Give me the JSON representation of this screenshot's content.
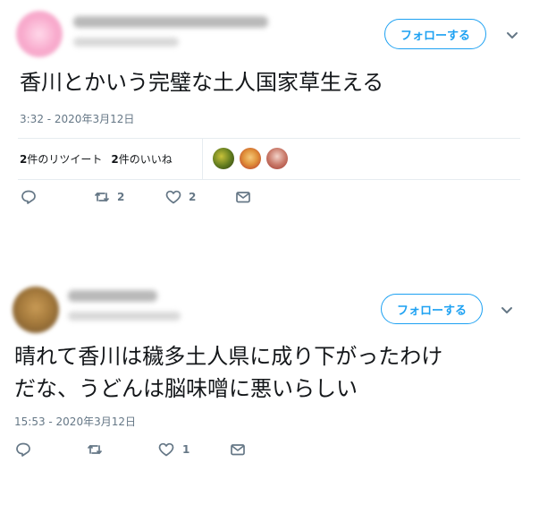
{
  "tweets": [
    {
      "follow_label": "フォローする",
      "text": "香川とかいう完璧な土人国家草生える",
      "timestamp": "3:32 - 2020年3月12日",
      "retweets_count": "2",
      "retweets_label": "件のリツイート",
      "likes_count": "2",
      "likes_label": "件のいいね",
      "actions": {
        "retweet_count": "2",
        "like_count": "2"
      }
    },
    {
      "follow_label": "フォローする",
      "text": "晴れて香川は穢多土人県に成り下がったわけ\nだな、うどんは脳味噌に悪いらしい",
      "timestamp": "15:53 - 2020年3月12日",
      "actions": {
        "retweet_count": "",
        "like_count": "1"
      }
    }
  ],
  "colors": {
    "accent": "#1da1f2",
    "muted": "#657786",
    "divider": "#e6ecf0"
  },
  "icons": [
    "reply-icon",
    "retweet-icon",
    "like-icon",
    "message-icon",
    "chevron-down-icon"
  ]
}
